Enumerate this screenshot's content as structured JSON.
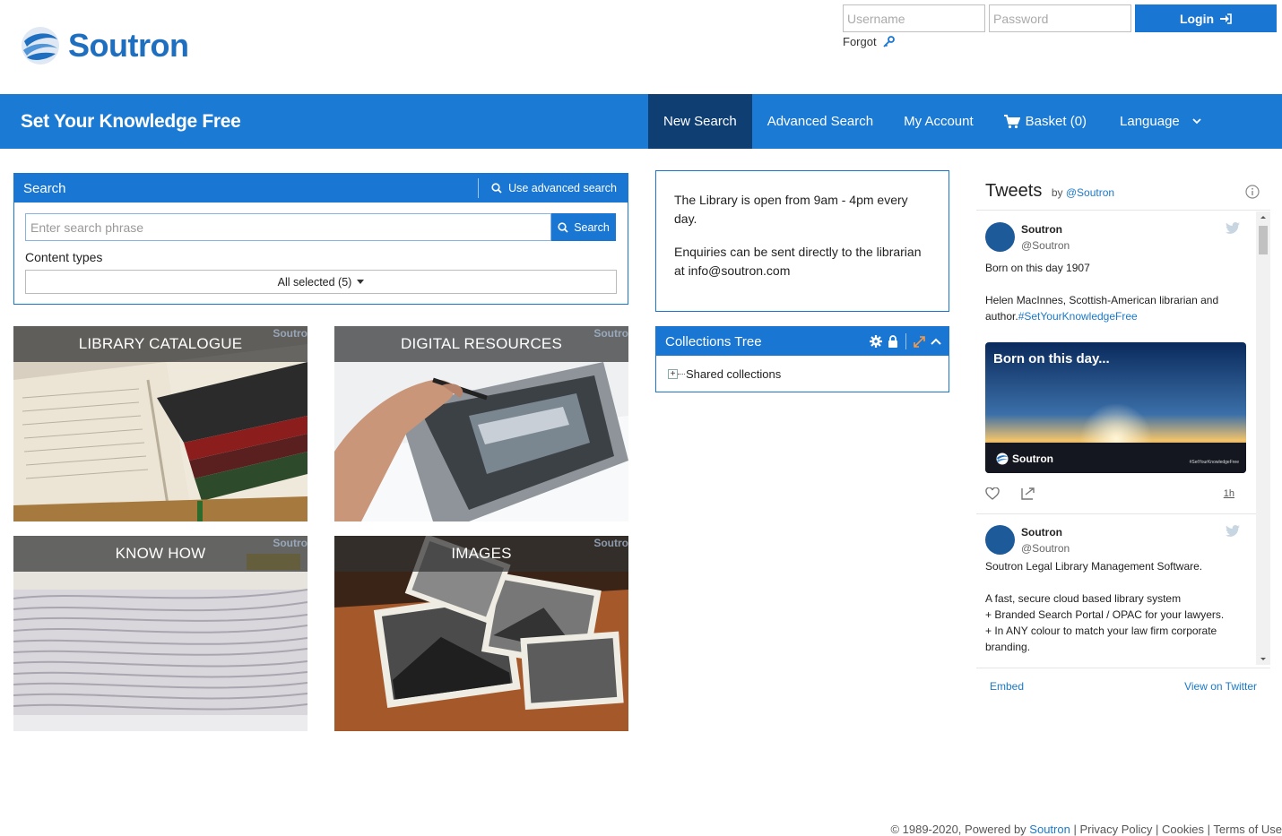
{
  "brand": {
    "name": "Soutron",
    "tagline": "Set Your Knowledge Free",
    "color": "#1f6fc0"
  },
  "login": {
    "username_placeholder": "Username",
    "password_placeholder": "Password",
    "login_label": "Login",
    "forgot_label": "Forgot"
  },
  "nav": {
    "items": [
      {
        "label": "New Search",
        "active": true
      },
      {
        "label": "Advanced Search"
      },
      {
        "label": "My Account"
      },
      {
        "label": "Basket (0)",
        "icon": "cart-icon"
      },
      {
        "label": "Language",
        "icon": "chevron-down-icon"
      }
    ]
  },
  "search": {
    "title": "Search",
    "advanced_link": "Use advanced search",
    "placeholder": "Enter search phrase",
    "button": "Search",
    "content_types_label": "Content types",
    "content_types_value": "All selected (5)"
  },
  "tiles": [
    {
      "title": "LIBRARY CATALOGUE",
      "watermark": "Soutro"
    },
    {
      "title": "DIGITAL RESOURCES",
      "watermark": "Soutro"
    },
    {
      "title": "KNOW HOW",
      "watermark": "Soutro"
    },
    {
      "title": "IMAGES",
      "watermark": "Soutro"
    }
  ],
  "info": {
    "line1": "The Library is open from 9am - 4pm every day.",
    "line2": "Enquiries can be sent directly to the librarian at info@soutron.com"
  },
  "collections": {
    "title": "Collections Tree",
    "root": "Shared collections"
  },
  "twitter": {
    "title": "Tweets",
    "by": "by",
    "handle_link": "@Soutron",
    "tweets": [
      {
        "name": "Soutron",
        "handle": "@Soutron",
        "text": "Born on this day 1907\n\nHelen MacInnes, Scottish-American librarian and author.",
        "hashtag": "#SetYourKnowledgeFree",
        "media_title": "Born on this day...",
        "media_brand": "Soutron",
        "media_tag": "#SetYourKnowledgeFree",
        "time": "1h"
      },
      {
        "name": "Soutron",
        "handle": "@Soutron",
        "text": "Soutron Legal Library Management Software.\n\nA fast, secure cloud based library system\n+ Branded Search Portal / OPAC for your lawyers.\n+ In ANY colour to match your law firm corporate branding."
      }
    ],
    "embed": "Embed",
    "view": "View on Twitter"
  },
  "footer": {
    "copyright": "© 1989-2020, Powered by",
    "powered_link": "Soutron",
    "sep": "|",
    "privacy": "Privacy Policy",
    "cookies": "Cookies",
    "terms": "Terms of Use"
  }
}
